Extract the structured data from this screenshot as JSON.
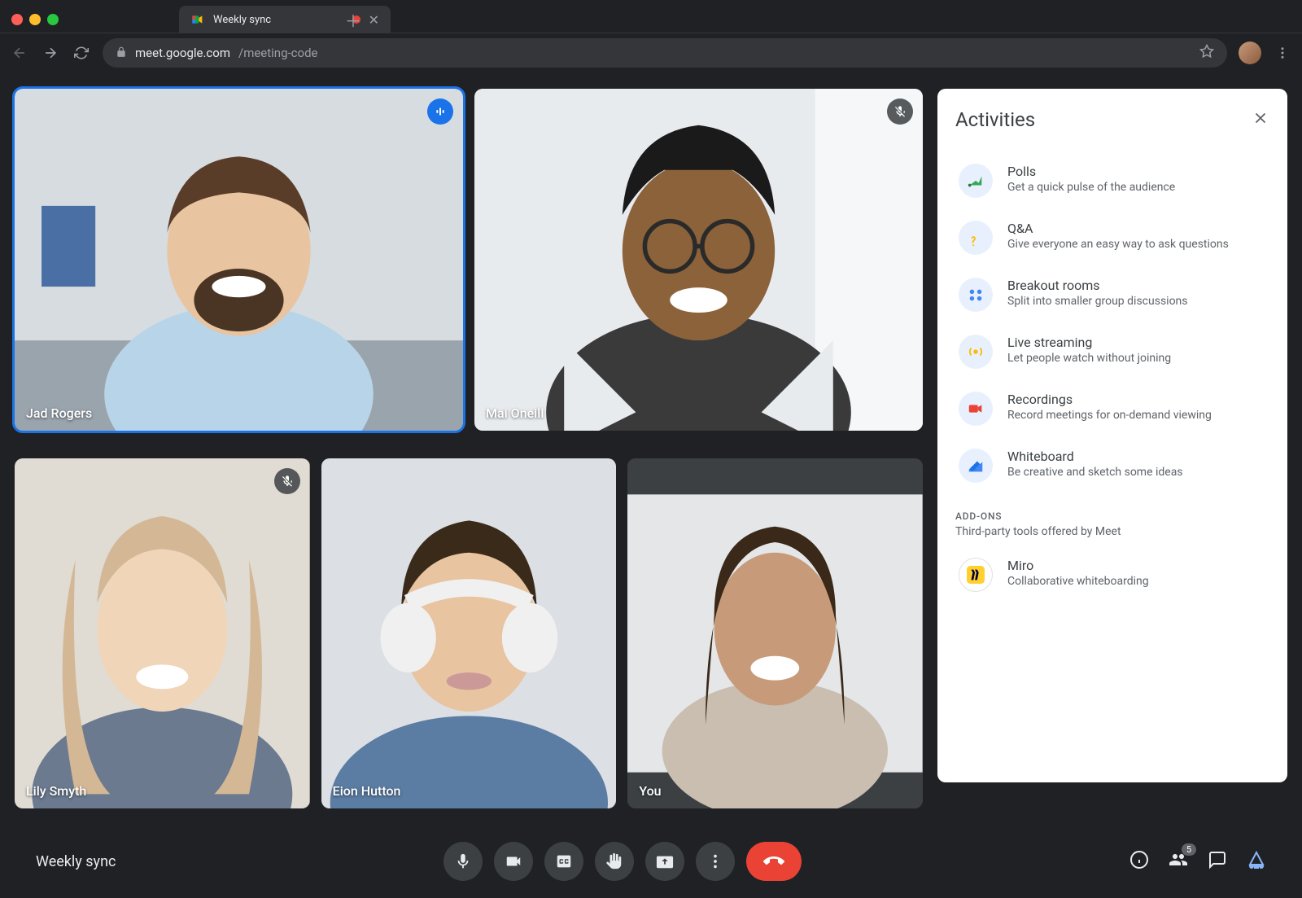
{
  "browser": {
    "tab_title": "Weekly sync",
    "url_host": "meet.google.com",
    "url_path": "/meeting-code"
  },
  "participants": {
    "top_left": {
      "name": "Jad Rogers",
      "mic": "speaking"
    },
    "top_right": {
      "name": "Mai Oneill",
      "mic": "muted"
    },
    "bottom": [
      {
        "name": "Lily Smyth",
        "mic": "muted"
      },
      {
        "name": "Eion Hutton",
        "mic": "none"
      },
      {
        "name": "You",
        "mic": "none"
      }
    ]
  },
  "panel": {
    "title": "Activities",
    "items": [
      {
        "title": "Polls",
        "desc": "Get a quick pulse of the audience",
        "icon": "polls"
      },
      {
        "title": "Q&A",
        "desc": "Give everyone an easy way to ask questions",
        "icon": "qa"
      },
      {
        "title": "Breakout rooms",
        "desc": "Split into smaller group discussions",
        "icon": "breakout"
      },
      {
        "title": "Live streaming",
        "desc": "Let people watch without joining",
        "icon": "live"
      },
      {
        "title": "Recordings",
        "desc": "Record meetings for on-demand viewing",
        "icon": "rec"
      },
      {
        "title": "Whiteboard",
        "desc": "Be creative and sketch some ideas",
        "icon": "whiteboard"
      }
    ],
    "addons_label": "ADD-ONS",
    "addons_sub": "Third-party tools offered by Meet",
    "addons": [
      {
        "title": "Miro",
        "desc": "Collaborative whiteboarding",
        "icon": "miro"
      }
    ]
  },
  "bottom": {
    "meeting_name": "Weekly sync",
    "participant_count": "5"
  }
}
